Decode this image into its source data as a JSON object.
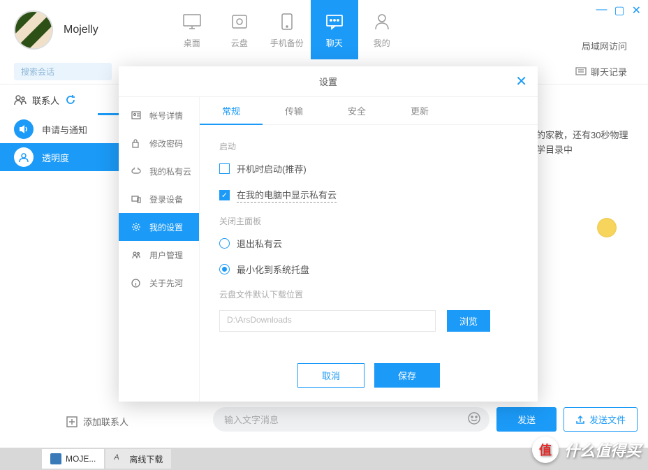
{
  "user": {
    "name": "Mojelly"
  },
  "window": {
    "min": "—",
    "max": "▢",
    "close": "✕"
  },
  "main_tabs": [
    {
      "label": "桌面"
    },
    {
      "label": "云盘"
    },
    {
      "label": "手机备份"
    },
    {
      "label": "聊天",
      "active": true
    },
    {
      "label": "我的"
    }
  ],
  "lan_access": "局域网访问",
  "search": {
    "placeholder": "搜索会话"
  },
  "chat_log": "聊天记录",
  "contacts_label": "联系人",
  "side_items": [
    {
      "label": "申请与通知"
    },
    {
      "label": "透明度",
      "selected": true
    }
  ],
  "notif_text": "的家教，还有30秒物理学目录中",
  "add_contact": "添加联系人",
  "msg_input": {
    "placeholder": "输入文字消息"
  },
  "send_label": "发送",
  "send_file_label": "发送文件",
  "taskbar": [
    {
      "label": "MOJE...",
      "active": true
    },
    {
      "label": "离线下载"
    }
  ],
  "watermark": {
    "badge": "值",
    "text": "什么值得买"
  },
  "modal": {
    "title": "设置",
    "side": [
      {
        "label": "帐号详情"
      },
      {
        "label": "修改密码"
      },
      {
        "label": "我的私有云"
      },
      {
        "label": "登录设备"
      },
      {
        "label": "我的设置",
        "active": true
      },
      {
        "label": "用户管理"
      },
      {
        "label": "关于先河"
      }
    ],
    "tabs": [
      {
        "label": "常规",
        "active": true
      },
      {
        "label": "传输"
      },
      {
        "label": "安全"
      },
      {
        "label": "更新"
      }
    ],
    "sections": {
      "startup": "启动",
      "startup_check": "开机时启动(推荐)",
      "show_cloud_check": "在我的电脑中显示私有云",
      "close_panel": "关闭主面板",
      "exit_cloud": "退出私有云",
      "minimize_tray": "最小化到系统托盘",
      "download_loc": "云盘文件默认下载位置",
      "path": "D:\\ArsDownloads",
      "browse": "浏览"
    },
    "cancel": "取消",
    "save": "保存"
  }
}
